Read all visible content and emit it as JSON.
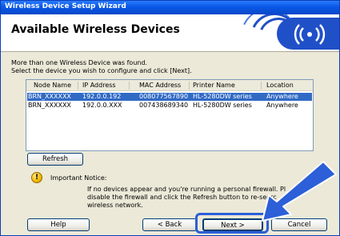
{
  "window": {
    "title": "Wireless Device Setup Wizard"
  },
  "header": {
    "heading": "Available Wireless Devices",
    "logo_icon": "wireless-signal-icon"
  },
  "intro": {
    "line1": "More than one Wireless Device was found.",
    "line2": "Select the device you wish to configure and click [Next]."
  },
  "devices": {
    "columns": [
      "Node Name",
      "IP Address",
      "MAC Address",
      "Printer Name",
      "Location"
    ],
    "rows": [
      {
        "node": "BRN_XXXXXX",
        "ip": "192.0.0.192",
        "mac": "008077567890",
        "printer": "HL-5280DW series",
        "location": "Anywhere",
        "selected": true
      },
      {
        "node": "BRN_XXXXXX",
        "ip": "192.0.0.XXX",
        "mac": "007438689340",
        "printer": "HL-5280DW series",
        "location": "Anywhere",
        "selected": false
      }
    ]
  },
  "buttons": {
    "refresh": "Refresh",
    "help": "Help",
    "back": "< Back",
    "next": "Next >",
    "cancel": "Cancel"
  },
  "notice": {
    "icon": "exclamation-icon",
    "title": "Important Notice:",
    "line1": "If no devices appear and you're running a personal firewall. Pl",
    "line2": "disable the firewall and click the Refresh button to re-searc",
    "line3": "wireless network."
  },
  "colors": {
    "titlebar": "#0a58e6",
    "selection": "#316ac5",
    "callout": "#2c5fd8"
  }
}
